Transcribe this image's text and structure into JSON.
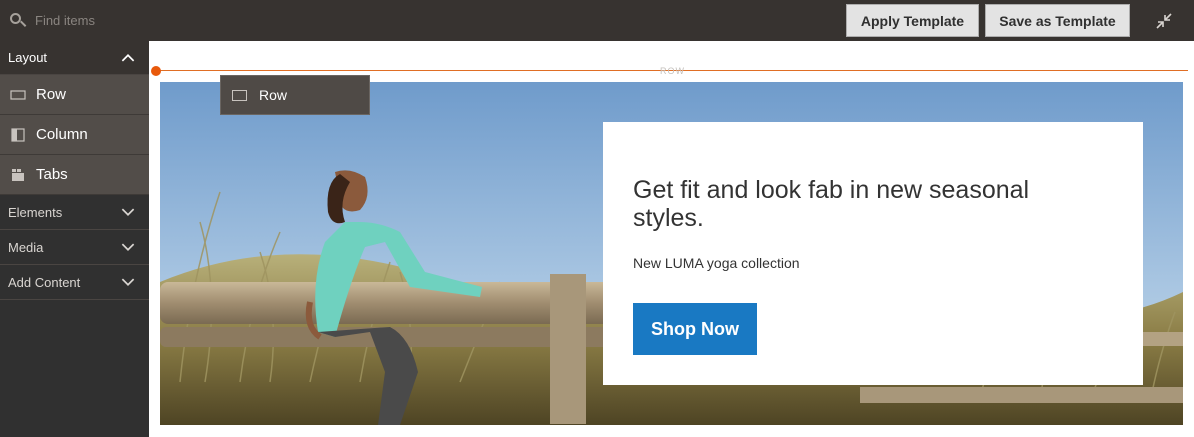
{
  "search": {
    "placeholder": "Find items"
  },
  "toolbar": {
    "apply_label": "Apply Template",
    "save_label": "Save as Template"
  },
  "sidebar": {
    "layout_header": "Layout",
    "items": [
      {
        "label": "Row",
        "icon": "row-icon"
      },
      {
        "label": "Column",
        "icon": "column-icon"
      },
      {
        "label": "Tabs",
        "icon": "tabs-icon"
      }
    ],
    "sections": [
      {
        "label": "Elements"
      },
      {
        "label": "Media"
      },
      {
        "label": "Add Content"
      }
    ]
  },
  "stage": {
    "row_marker": "ROW",
    "row_tag_label": "Row",
    "banner": {
      "heading": "Get fit and look fab in new seasonal styles.",
      "subtext": "New LUMA yoga collection",
      "button_label": "Shop Now"
    }
  },
  "colors": {
    "topbar": "#373330",
    "sidebar": "#303030",
    "accent_orange": "#e8590c",
    "button_blue": "#1979c3"
  }
}
